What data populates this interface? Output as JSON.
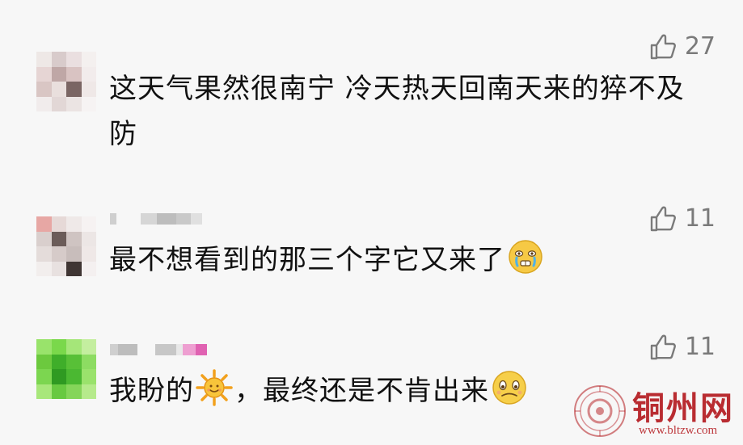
{
  "comments": [
    {
      "text": "这天气果然很南宁 冷天热天回南天来的猝不及防",
      "likes": "27",
      "avatar_colors": [
        "#eee8e6",
        "#d8cbcb",
        "#eadfe0",
        "#f4f0ef",
        "#e6d5d4",
        "#bfa7a6",
        "#d9c3c2",
        "#f2ecec",
        "#d9c6c4",
        "#e9dfdd",
        "#7a6563",
        "#efe8e7",
        "#f1ecec",
        "#e2d7d6",
        "#ebe4e3",
        "#f6f3f3"
      ]
    },
    {
      "text": "最不想看到的那三个字它又来了",
      "emoji": "crying-face",
      "likes": "11",
      "avatar_colors": [
        "#e7a7a4",
        "#e6d9d7",
        "#efe9e8",
        "#f6f2f2",
        "#d9cfcd",
        "#6b5c59",
        "#cfc4c2",
        "#ece6e5",
        "#e4dcda",
        "#d6cbc9",
        "#c8bdbb",
        "#efe8e7",
        "#f2eeed",
        "#e8e1e0",
        "#3f3533",
        "#f4f0f0"
      ]
    },
    {
      "text_before": "我盼的",
      "emoji_sun": "sun-emoji",
      "text_after": "，最终还是不肯出来",
      "emoji": "shy-sad-face",
      "likes": "11",
      "avatar_colors": [
        "#99e36b",
        "#7ad84b",
        "#a5e679",
        "#c4ee9f",
        "#6cc93e",
        "#3fae2a",
        "#58c037",
        "#8ddc62",
        "#7cd650",
        "#2f9a22",
        "#4bb832",
        "#9ae26c",
        "#a8e77b",
        "#68c941",
        "#85d55a",
        "#b6ea8c"
      ]
    }
  ],
  "icons": {
    "like": "thumbs-up-icon"
  },
  "watermark": {
    "title": "铜州网",
    "url": "www.bltzw.com",
    "color": "#b3171c"
  }
}
